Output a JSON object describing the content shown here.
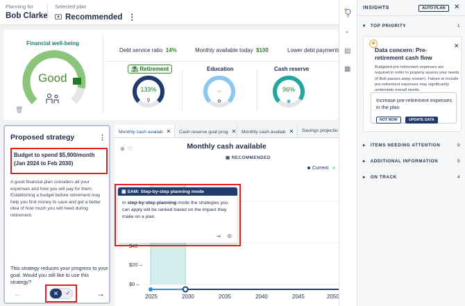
{
  "header": {
    "planning_for_label": "Planning for",
    "client_name": "Bob Clarke",
    "selected_plan_label": "Selected plan",
    "plan_name": "Recommended",
    "kebab": "⋮"
  },
  "wellbeing": {
    "title": "Financial well-being",
    "status": "Good",
    "level": 0.88
  },
  "metrics": [
    {
      "label": "Debt service ratio",
      "value": "14%"
    },
    {
      "label": "Monthly available today",
      "value": "$100"
    },
    {
      "label": "Lower debt payments",
      "value": ""
    }
  ],
  "gauges": [
    {
      "label": "Retirement",
      "value": "133%",
      "level": 1.0,
      "color": "#1f3a6b"
    },
    {
      "label": "Education",
      "value": "--",
      "level": 1.0,
      "color": "#8cc8ee"
    },
    {
      "label": "Cash reserve",
      "value": "96%",
      "level": 0.96,
      "color": "#22a7a0"
    }
  ],
  "strategy": {
    "title": "Proposed strategy",
    "kebab": "⋮",
    "budget": "Budget to spend $5,900/month (Jan 2024 to Feb 2030)",
    "description": "A good financial plan considers all your expenses and how you will pay for them. Establishing a budget before retirement may help you find money to save and get a better idea of how much you will need during retirement.",
    "question": "This strategy reduces your progress to your goal. Would you still like to use this strategy?",
    "prev": "←",
    "next": "→",
    "reject": "✕",
    "accept": "✓"
  },
  "chart_panel": {
    "tabs": [
      {
        "label": "Monthly cash availab",
        "close": "✕"
      },
      {
        "label": "Cash reserve goal prog",
        "close": "✕"
      },
      {
        "label": "Monthly cash availab",
        "close": "✕"
      },
      {
        "label": "Savings projectio",
        "close": ""
      }
    ],
    "recommended_badge": "RECOMMENDED",
    "legend_current": "Current"
  },
  "chart_data": {
    "type": "area",
    "title": "Monthly cash available",
    "x_ticks": [
      "2025",
      "2030",
      "2035",
      "2040",
      "2045",
      "2050"
    ],
    "y_ticks": [
      "$40",
      "$20 –",
      "$0 –"
    ],
    "x_range": [
      2024,
      2052
    ],
    "y_range": [
      0,
      50
    ],
    "series": [
      {
        "name": "Current",
        "color": "#1f3a6b"
      }
    ],
    "highlight_range": [
      2025,
      2030
    ]
  },
  "sam": {
    "header": "SAM: Step-by-step planning mode",
    "text_prefix": "In ",
    "text_bold": "step-by-step planning",
    "text_suffix": " mode the strategies you can apply will be ranked based on the impact they make on a plan."
  },
  "insights": {
    "title": "INSIGHTS",
    "auto_plan": "AUTO PLAN",
    "close": "✕",
    "sections": [
      {
        "label": "TOP PRIORITY",
        "count": "1",
        "arrow": "▾"
      },
      {
        "label": "ITEMS NEEDING ATTENTION",
        "count": "9",
        "arrow": "▸"
      },
      {
        "label": "ADDITIONAL INFORMATION",
        "count": "5",
        "arrow": "▸"
      },
      {
        "label": "ON TRACK",
        "count": "4",
        "arrow": "▸"
      }
    ],
    "concern": {
      "title": "Data concern: Pre-retirement cash flow",
      "body": "Budgeted pre-retirement expenses are required in order to properly assess your needs (if Bob passes away sooner). Failure to include pre-retirement expenses may significantly understate overall needs.",
      "action": "Increase pre-retirement expenses in the plan",
      "not_now": "NOT NOW",
      "update": "UPDATE DATA"
    }
  }
}
